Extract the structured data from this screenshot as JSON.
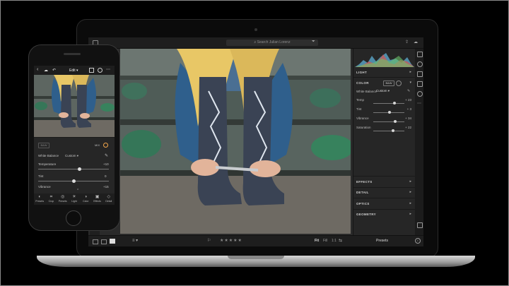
{
  "desktop": {
    "search_placeholder": "Search Julian Lorenz",
    "panels": {
      "light": "LIGHT",
      "color": "COLOR",
      "bw": "B&W",
      "white_balance_label": "White Balance",
      "white_balance_value": "Custom",
      "sliders": [
        {
          "label": "Temp",
          "value": "+ 23",
          "pos": 0.68
        },
        {
          "label": "Tint",
          "value": "+ 3",
          "pos": 0.52
        },
        {
          "label": "Vibrance",
          "value": "+ 34",
          "pos": 0.7
        },
        {
          "label": "Saturation",
          "value": "+ 22",
          "pos": 0.64
        }
      ],
      "effects": "EFFECTS",
      "detail": "DETAIL",
      "optics": "OPTICS",
      "geometry": "GEOMETRY"
    },
    "bottom": {
      "fit": "Fit",
      "fill": "Fill",
      "ratio": "1:1",
      "stars": "★★★★★",
      "presets": "Presets"
    }
  },
  "mobile": {
    "header_title": "Edit",
    "bw": "B&W",
    "wb_label": "White Balance",
    "wb_value": "Custom",
    "temperature_label": "Temperature",
    "temperature_value": "+10",
    "tint_label": "Tint",
    "tint_value": "0",
    "vibrance_label": "Vibrance",
    "vibrance_value": "+15",
    "tools": [
      "Presets",
      "Crop",
      "Presets",
      "Light",
      "Color",
      "Effects",
      "Detail"
    ]
  },
  "colors": {
    "accent": "#f3a74a",
    "panel_bg": "#262626"
  }
}
